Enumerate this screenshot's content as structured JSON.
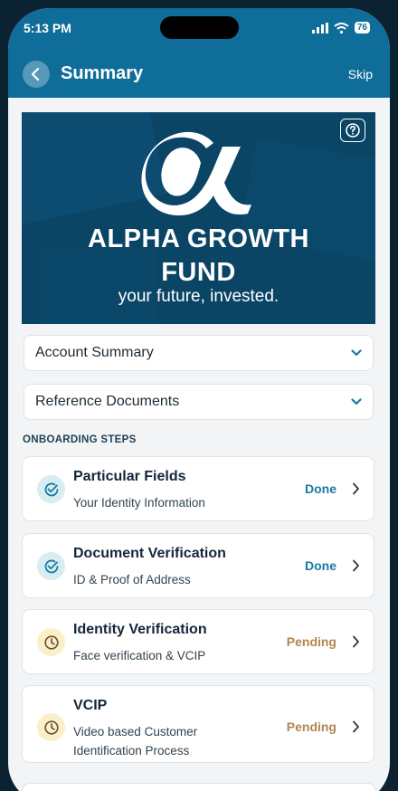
{
  "status_bar": {
    "time": "5:13 PM",
    "battery": "76"
  },
  "header": {
    "title": "Summary",
    "skip_label": "Skip"
  },
  "hero": {
    "title_line1": "ALPHA GROWTH",
    "title_line2": "FUND",
    "tagline": "your future, invested."
  },
  "accordions": [
    {
      "label": "Account Summary"
    },
    {
      "label": "Reference Documents"
    }
  ],
  "section_title": "ONBOARDING STEPS",
  "steps": [
    {
      "title": "Particular Fields",
      "subtitle": "Your Identity Information",
      "status": "Done"
    },
    {
      "title": "Document Verification",
      "subtitle": "ID & Proof of Address",
      "status": "Done"
    },
    {
      "title": "Identity Verification",
      "subtitle": "Face verification & VCIP",
      "status": "Pending"
    },
    {
      "title": "VCIP",
      "subtitle": "Video based Customer Identification Process",
      "status": "Pending"
    }
  ],
  "colors": {
    "header": "#0f6d99",
    "done": "#1a7aa6",
    "pending": "#b08750",
    "hero_bg": "#0a4566"
  }
}
